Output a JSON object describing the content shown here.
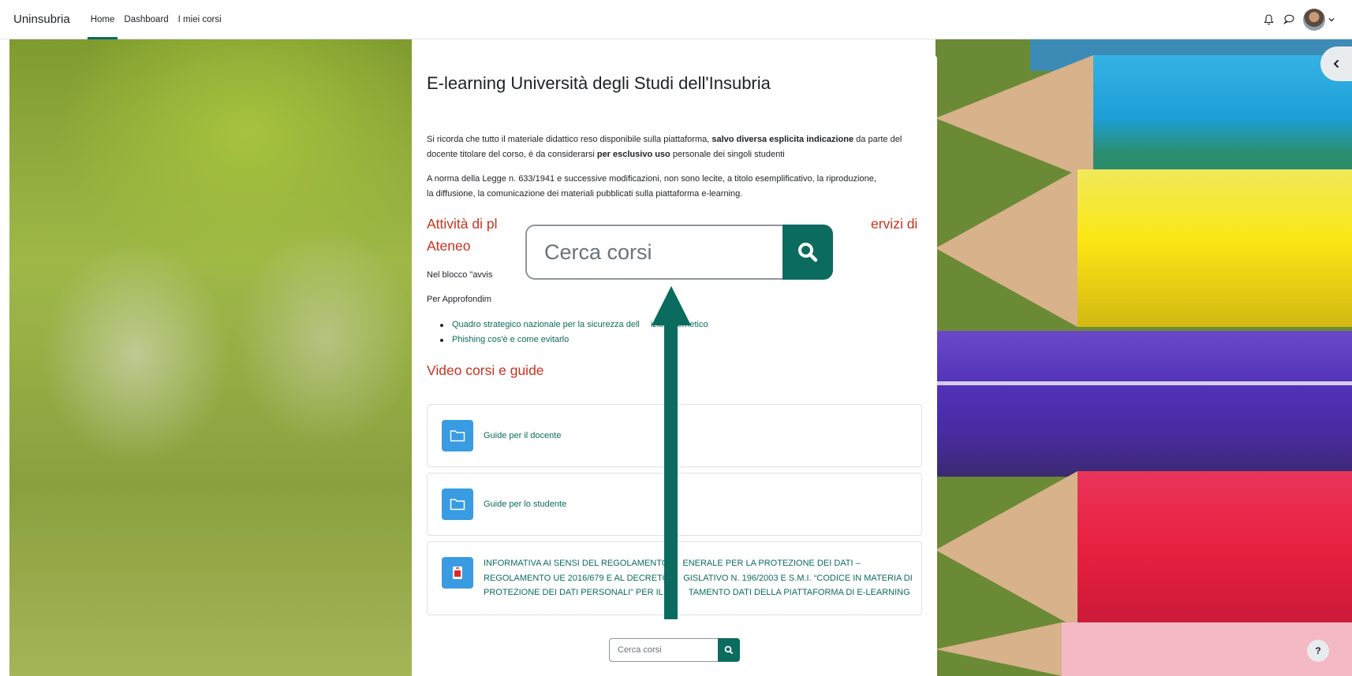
{
  "navbar": {
    "brand": "Uninsubria",
    "links": [
      "Home",
      "Dashboard",
      "I miei corsi"
    ],
    "icons": [
      "bell-icon",
      "chat-icon",
      "user-avatar",
      "chevron-down-icon"
    ]
  },
  "main": {
    "title": "E-learning Università degli Studi dell'Insubria",
    "para1": {
      "a": "Si ricorda che tutto il materiale didattico reso disponibile sulla piattaforma, ",
      "b": "salvo diversa esplicita indicazione",
      "c": " da parte del",
      "d": "docente titolare del corso, è da considerarsi ",
      "e": "per esclusivo uso",
      "f": " personale dei singoli studenti"
    },
    "para2": {
      "line1": "A norma della Legge n. 633/1941 e successive modificazioni, non sono lecite, a titolo esemplificativo, la riproduzione,",
      "line2": "la diffusione, la comunicazione dei materiali pubblicati sulla piattaforma e-learning."
    },
    "heading1": {
      "line1_visible_left": "Attività di pl",
      "line1_visible_right": "ervizi di",
      "line2": "Ateneo"
    },
    "nel_blocco": "Nel blocco \"avvis",
    "per_approfondim": "Per Approfondim",
    "links": [
      {
        "pre": "Quadro strategico nazionale per la sicurezza dell",
        "post": "izio cibernetico"
      },
      {
        "pre": "Phishing cos'è e come evitarlo",
        "post": ""
      }
    ],
    "heading2": "Video corsi e guide",
    "activities": [
      {
        "label": "Guide per il docente",
        "icon": "folder-icon"
      },
      {
        "label": "Guide per lo studente",
        "icon": "folder-icon"
      },
      {
        "lines": [
          {
            "a": "INFORMATIVA AI SENSI DEL REGOLAMENTO ",
            "b": "ENERALE PER LA PROTEZIONE DEI DATI –"
          },
          {
            "a": "REGOLAMENTO UE 2016/679 E AL DECRETO ",
            "b": "GISLATIVO N. 196/2003 E S.M.I. “CODICE IN MATERIA DI"
          },
          {
            "a": "PROTEZIONE DEI DATI PERSONALI” PER IL TR",
            "b": "TAMENTO DATI DELLA PIATTAFORMA DI E-LEARNING"
          }
        ],
        "icon": "pdf-icon"
      }
    ],
    "search": {
      "placeholder": "Cerca corsi"
    }
  },
  "overlay": {
    "search_placeholder": "Cerca corsi"
  },
  "help_label": "?",
  "colors": {
    "accent": "#0b6b5f",
    "heading_red": "#ca3120",
    "activity_icon": "#399be2"
  }
}
